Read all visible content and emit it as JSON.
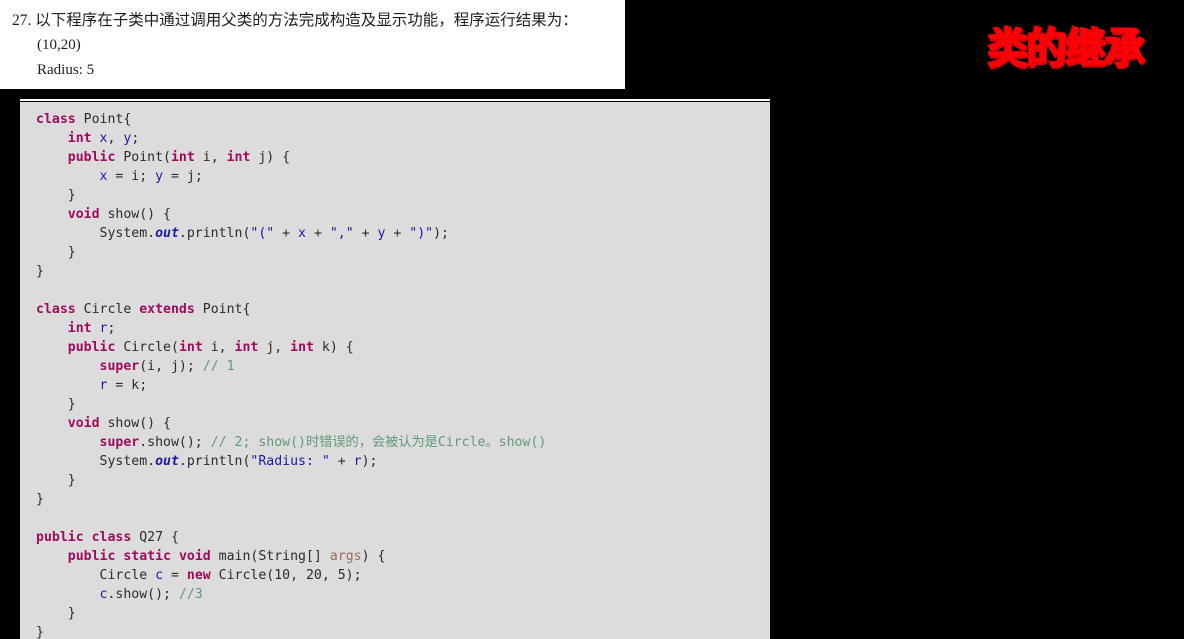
{
  "question_card": {
    "number": "27.",
    "prompt": "以下程序在子类中通过调用父类的方法完成构造及显示功能，程序运行结果为：",
    "heading_line": "27. 以下程序在子类中通过调用父类的方法完成构造及显示功能，程序运行结果为：",
    "output_lines": [
      "(10,20)",
      "Radius: 5"
    ]
  },
  "slide_heading": {
    "text": "类的继承",
    "color": "#fb0007"
  },
  "code_panel": {
    "background": "#dcdcdc",
    "colors": {
      "keyword": "#a00a5e",
      "variable": "#1a1aa6",
      "string": "#1a1aa6",
      "comment": "#5f9a78",
      "field": "#1a1aa6",
      "parameter": "#9a6b5c",
      "plain": "#2b2b2b"
    },
    "lines": [
      [
        {
          "t": "class",
          "c": "kw"
        },
        {
          "t": " Point{",
          "c": "pln"
        }
      ],
      [
        {
          "t": "    ",
          "c": "pln"
        },
        {
          "t": "int",
          "c": "kw"
        },
        {
          "t": " ",
          "c": "pln"
        },
        {
          "t": "x",
          "c": "var"
        },
        {
          "t": ", ",
          "c": "pln"
        },
        {
          "t": "y",
          "c": "var"
        },
        {
          "t": ";",
          "c": "pln"
        }
      ],
      [
        {
          "t": "    ",
          "c": "pln"
        },
        {
          "t": "public",
          "c": "kw"
        },
        {
          "t": " Point(",
          "c": "pln"
        },
        {
          "t": "int",
          "c": "kw"
        },
        {
          "t": " i, ",
          "c": "pln"
        },
        {
          "t": "int",
          "c": "kw"
        },
        {
          "t": " j) {",
          "c": "pln"
        }
      ],
      [
        {
          "t": "        ",
          "c": "pln"
        },
        {
          "t": "x",
          "c": "var"
        },
        {
          "t": " = i; ",
          "c": "pln"
        },
        {
          "t": "y",
          "c": "var"
        },
        {
          "t": " = j;",
          "c": "pln"
        }
      ],
      [
        {
          "t": "    }",
          "c": "pln"
        }
      ],
      [
        {
          "t": "    ",
          "c": "pln"
        },
        {
          "t": "void",
          "c": "kw"
        },
        {
          "t": " show() {",
          "c": "pln"
        }
      ],
      [
        {
          "t": "        System.",
          "c": "pln"
        },
        {
          "t": "out",
          "c": "fld"
        },
        {
          "t": ".println(",
          "c": "pln"
        },
        {
          "t": "\"(\"",
          "c": "str"
        },
        {
          "t": " + ",
          "c": "pln"
        },
        {
          "t": "x",
          "c": "var"
        },
        {
          "t": " + ",
          "c": "pln"
        },
        {
          "t": "\",\"",
          "c": "str"
        },
        {
          "t": " + ",
          "c": "pln"
        },
        {
          "t": "y",
          "c": "var"
        },
        {
          "t": " + ",
          "c": "pln"
        },
        {
          "t": "\")\"",
          "c": "str"
        },
        {
          "t": ");",
          "c": "pln"
        }
      ],
      [
        {
          "t": "    }",
          "c": "pln"
        }
      ],
      [
        {
          "t": "}",
          "c": "pln"
        }
      ],
      [],
      [
        {
          "t": "class",
          "c": "kw"
        },
        {
          "t": " Circle ",
          "c": "pln"
        },
        {
          "t": "extends",
          "c": "kw"
        },
        {
          "t": " Point{",
          "c": "pln"
        }
      ],
      [
        {
          "t": "    ",
          "c": "pln"
        },
        {
          "t": "int",
          "c": "kw"
        },
        {
          "t": " ",
          "c": "pln"
        },
        {
          "t": "r",
          "c": "var"
        },
        {
          "t": ";",
          "c": "pln"
        }
      ],
      [
        {
          "t": "    ",
          "c": "pln"
        },
        {
          "t": "public",
          "c": "kw"
        },
        {
          "t": " Circle(",
          "c": "pln"
        },
        {
          "t": "int",
          "c": "kw"
        },
        {
          "t": " i, ",
          "c": "pln"
        },
        {
          "t": "int",
          "c": "kw"
        },
        {
          "t": " j, ",
          "c": "pln"
        },
        {
          "t": "int",
          "c": "kw"
        },
        {
          "t": " k) {",
          "c": "pln"
        }
      ],
      [
        {
          "t": "        ",
          "c": "pln"
        },
        {
          "t": "super",
          "c": "kw"
        },
        {
          "t": "(i, j); ",
          "c": "pln"
        },
        {
          "t": "// 1",
          "c": "cmt"
        }
      ],
      [
        {
          "t": "        ",
          "c": "pln"
        },
        {
          "t": "r",
          "c": "var"
        },
        {
          "t": " = k;",
          "c": "pln"
        }
      ],
      [
        {
          "t": "    }",
          "c": "pln"
        }
      ],
      [
        {
          "t": "    ",
          "c": "pln"
        },
        {
          "t": "void",
          "c": "kw"
        },
        {
          "t": " show() {",
          "c": "pln"
        }
      ],
      [
        {
          "t": "        ",
          "c": "pln"
        },
        {
          "t": "super",
          "c": "kw"
        },
        {
          "t": ".show(); ",
          "c": "pln"
        },
        {
          "t": "// 2; show()时错误的，会被认为是Circle。show()",
          "c": "cmt"
        }
      ],
      [
        {
          "t": "        System.",
          "c": "pln"
        },
        {
          "t": "out",
          "c": "fld"
        },
        {
          "t": ".println(",
          "c": "pln"
        },
        {
          "t": "\"Radius: \"",
          "c": "str"
        },
        {
          "t": " + ",
          "c": "pln"
        },
        {
          "t": "r",
          "c": "var"
        },
        {
          "t": ");",
          "c": "pln"
        }
      ],
      [
        {
          "t": "    }",
          "c": "pln"
        }
      ],
      [
        {
          "t": "}",
          "c": "pln"
        }
      ],
      [],
      [
        {
          "t": "public",
          "c": "kw"
        },
        {
          "t": " ",
          "c": "pln"
        },
        {
          "t": "class",
          "c": "kw"
        },
        {
          "t": " Q27 {",
          "c": "pln"
        }
      ],
      [
        {
          "t": "    ",
          "c": "pln"
        },
        {
          "t": "public",
          "c": "kw"
        },
        {
          "t": " ",
          "c": "pln"
        },
        {
          "t": "static",
          "c": "kw"
        },
        {
          "t": " ",
          "c": "pln"
        },
        {
          "t": "void",
          "c": "kw"
        },
        {
          "t": " main(String[] ",
          "c": "pln"
        },
        {
          "t": "args",
          "c": "prm"
        },
        {
          "t": ") {",
          "c": "pln"
        }
      ],
      [
        {
          "t": "        Circle ",
          "c": "pln"
        },
        {
          "t": "c",
          "c": "var"
        },
        {
          "t": " = ",
          "c": "pln"
        },
        {
          "t": "new",
          "c": "kw"
        },
        {
          "t": " Circle(10, 20, 5);",
          "c": "pln"
        }
      ],
      [
        {
          "t": "        ",
          "c": "pln"
        },
        {
          "t": "c",
          "c": "var"
        },
        {
          "t": ".show(); ",
          "c": "pln"
        },
        {
          "t": "//3",
          "c": "cmt"
        }
      ],
      [
        {
          "t": "    }",
          "c": "pln"
        }
      ],
      [
        {
          "t": "}",
          "c": "pln"
        }
      ]
    ]
  }
}
